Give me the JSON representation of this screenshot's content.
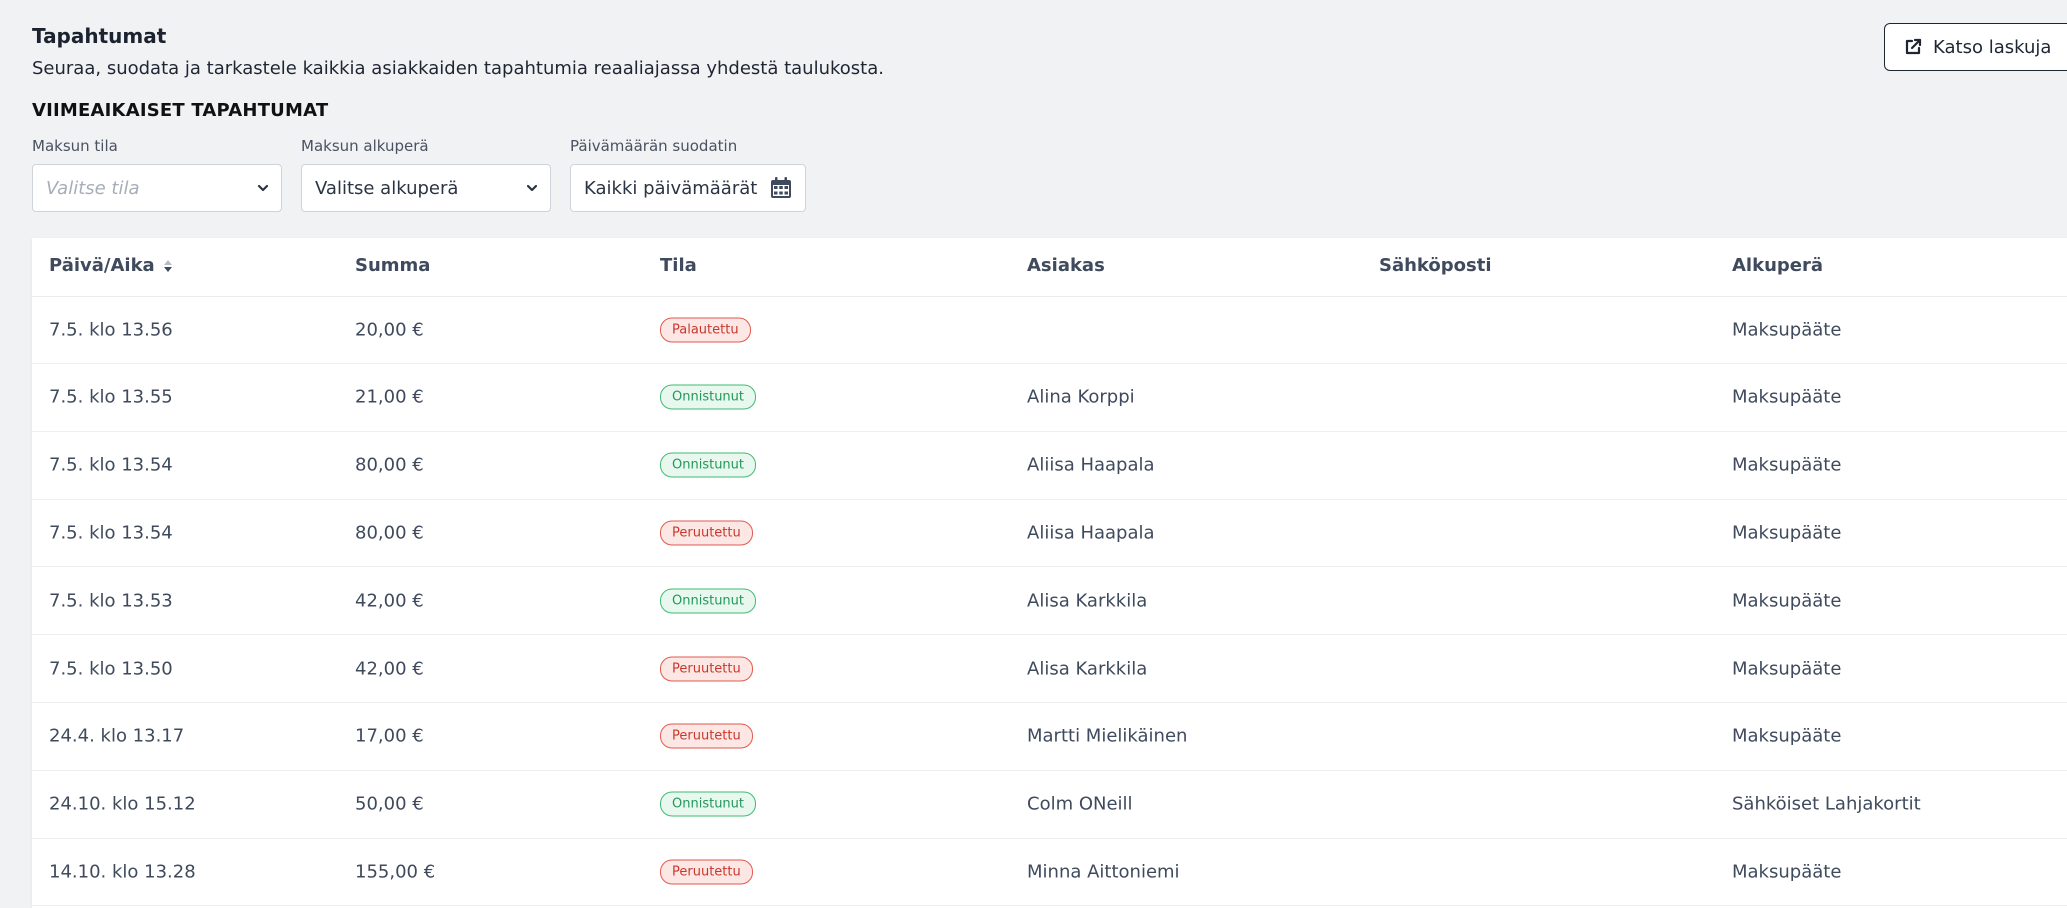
{
  "header": {
    "title": "Tapahtumat",
    "subtitle": "Seuraa, suodata ja tarkastele kaikkia asiakkaiden tapahtumia reaaliajassa yhdestä taulukosta.",
    "section_title": "VIIMEAIKAISET TAPAHTUMAT",
    "invoices_button": {
      "label": "Katso laskuja",
      "icon": "external-link-icon"
    }
  },
  "filters": {
    "status": {
      "label": "Maksun tila",
      "placeholder": "Valitse tila",
      "icon": "chevron-down-icon"
    },
    "origin": {
      "label": "Maksun alkuperä",
      "value": "Valitse alkuperä",
      "icon": "chevron-down-icon"
    },
    "date": {
      "label": "Päivämäärän suodatin",
      "value": "Kaikki päivämäärät",
      "icon": "calendar-icon"
    }
  },
  "table": {
    "columns": [
      "Päivä/Aika",
      "Summa",
      "Tila",
      "Asiakas",
      "Sähköposti",
      "Alkuperä"
    ],
    "rows": [
      {
        "datetime": "7.5. klo 13.56",
        "amount": "20,00 €",
        "status": "Palautettu",
        "status_type": "error",
        "customer": "",
        "email": "",
        "origin": "Maksupääte"
      },
      {
        "datetime": "7.5. klo 13.55",
        "amount": "21,00 €",
        "status": "Onnistunut",
        "status_type": "success",
        "customer": "Alina Korppi",
        "email": "",
        "origin": "Maksupääte"
      },
      {
        "datetime": "7.5. klo 13.54",
        "amount": "80,00 €",
        "status": "Onnistunut",
        "status_type": "success",
        "customer": "Aliisa Haapala",
        "email": "",
        "origin": "Maksupääte"
      },
      {
        "datetime": "7.5. klo 13.54",
        "amount": "80,00 €",
        "status": "Peruutettu",
        "status_type": "error",
        "customer": "Aliisa Haapala",
        "email": "",
        "origin": "Maksupääte"
      },
      {
        "datetime": "7.5. klo 13.53",
        "amount": "42,00 €",
        "status": "Onnistunut",
        "status_type": "success",
        "customer": "Alisa Karkkila",
        "email": "",
        "origin": "Maksupääte"
      },
      {
        "datetime": "7.5. klo 13.50",
        "amount": "42,00 €",
        "status": "Peruutettu",
        "status_type": "error",
        "customer": "Alisa Karkkila",
        "email": "",
        "origin": "Maksupääte"
      },
      {
        "datetime": "24.4. klo 13.17",
        "amount": "17,00 €",
        "status": "Peruutettu",
        "status_type": "error",
        "customer": "Martti Mielikäinen",
        "email": "",
        "origin": "Maksupääte"
      },
      {
        "datetime": "24.10. klo 15.12",
        "amount": "50,00 €",
        "status": "Onnistunut",
        "status_type": "success",
        "customer": "Colm ONeill",
        "email": "",
        "origin": "Sähköiset Lahjakortit"
      },
      {
        "datetime": "14.10. klo 13.28",
        "amount": "155,00 €",
        "status": "Peruutettu",
        "status_type": "error",
        "customer": "Minna Aittoniemi",
        "email": "",
        "origin": "Maksupääte"
      }
    ]
  },
  "colors": {
    "background": "#f1f2f4",
    "error_badge": "#e2584c",
    "success_badge": "#3fbb72",
    "text": "#3f4a5c"
  }
}
